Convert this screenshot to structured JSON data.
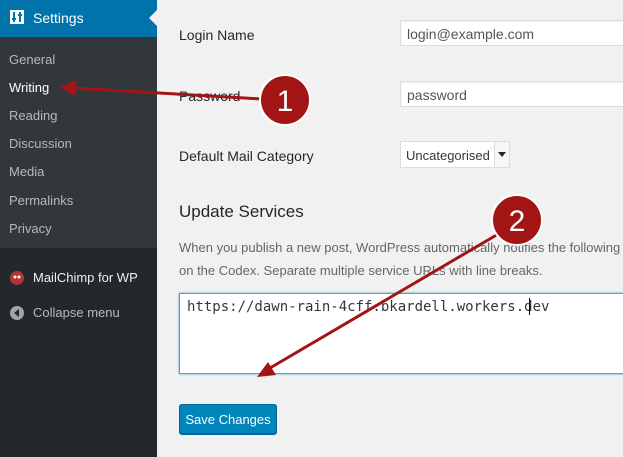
{
  "sidebar": {
    "settings_label": "Settings",
    "submenu": [
      "General",
      "Writing",
      "Reading",
      "Discussion",
      "Media",
      "Permalinks",
      "Privacy"
    ],
    "current_item": "Writing",
    "plugin_item": "MailChimp for WP",
    "collapse_label": "Collapse menu"
  },
  "form": {
    "login_label": "Login Name",
    "login_value": "login@example.com",
    "password_label": "Password",
    "password_value": "password",
    "mail_category_label": "Default Mail Category",
    "mail_category_value": "Uncategorised"
  },
  "update_services": {
    "title": "Update Services",
    "description_line1": "When you publish a new post, WordPress automatically notifies the following site",
    "description_line2": "on the Codex. Separate multiple service URLs with line breaks.",
    "ping_sites": "https://dawn-rain-4cff.bkardell.workers.dev"
  },
  "save_label": "Save Changes",
  "annotations": {
    "badge1": "1",
    "badge2": "2",
    "color": "#a31515"
  },
  "colors": {
    "sidebar_bg": "#23282d",
    "submenu_bg": "#32373c",
    "accent": "#0073aa",
    "button": "#0085ba"
  }
}
